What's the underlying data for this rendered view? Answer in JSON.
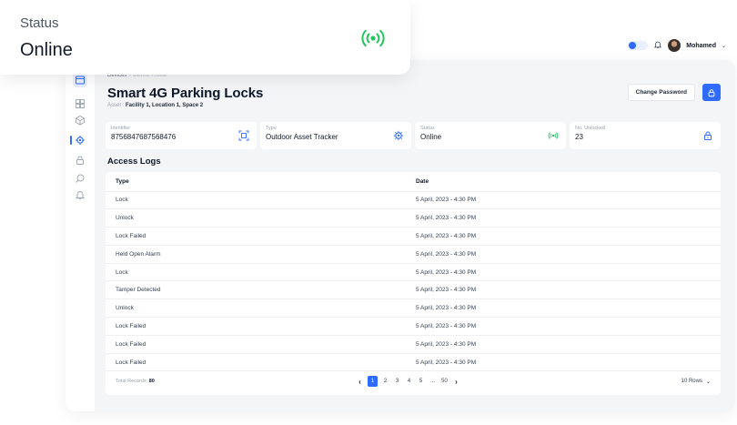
{
  "status_card": {
    "label": "Status",
    "value": "Online",
    "icon": "broadcast-icon",
    "icon_color": "#22c55e"
  },
  "topbar": {
    "username": "Mohamed",
    "chevron": "⌄"
  },
  "breadcrumb": {
    "parent": "Devices",
    "separator": ">",
    "current": "Device Profile"
  },
  "page": {
    "title": "Smart 4G Parking Locks",
    "asset_prefix": "Asset :",
    "asset_value": "Facility 1, Location 1, Space 2"
  },
  "actions": {
    "change_password": "Change Password",
    "lock_icon": "lock-icon"
  },
  "cards": [
    {
      "label": "Identifier",
      "value": "8756847687568476",
      "icon": "scan-icon"
    },
    {
      "label": "Type",
      "value": "Outdoor Asset Tracker",
      "icon": "chip-icon"
    },
    {
      "label": "Status",
      "value": "Online",
      "icon": "broadcast-icon"
    },
    {
      "label": "No. Unlocked",
      "value": "23",
      "icon": "lock-icon"
    }
  ],
  "section_title": "Access Logs",
  "table": {
    "headers": [
      "Type",
      "Date"
    ],
    "rows": [
      [
        "Lock",
        "5 April, 2023 - 4:30  PM"
      ],
      [
        "Unlock",
        "5 April, 2023 - 4:30  PM"
      ],
      [
        "Lock Failed",
        "5 April, 2023 - 4:30  PM"
      ],
      [
        "Held Open Alarm",
        "5 April, 2023 - 4:30  PM"
      ],
      [
        "Lock",
        "5 April, 2023 - 4:30  PM"
      ],
      [
        "Tamper Detected",
        "5 April, 2023 - 4:30  PM"
      ],
      [
        "Unlock",
        "5 April, 2023 - 4:30  PM"
      ],
      [
        "Lock Failed",
        "5 April, 2023 - 4:30  PM"
      ],
      [
        "Lock Failed",
        "5 April, 2023 - 4:30  PM"
      ],
      [
        "Lock Failed",
        "5 April, 2023 - 4:30  PM"
      ]
    ]
  },
  "footer": {
    "total_label": "Total Records:",
    "total_value": "80",
    "pages": [
      "1",
      "2",
      "3",
      "4",
      "5",
      "...",
      "50"
    ],
    "prev": "‹",
    "next": "›",
    "rows_per_page": "10 Rows",
    "rows_chevron": "⌄"
  },
  "colors": {
    "accent": "#2f6bff",
    "online": "#22c55e",
    "background": "#f4f5f7"
  }
}
